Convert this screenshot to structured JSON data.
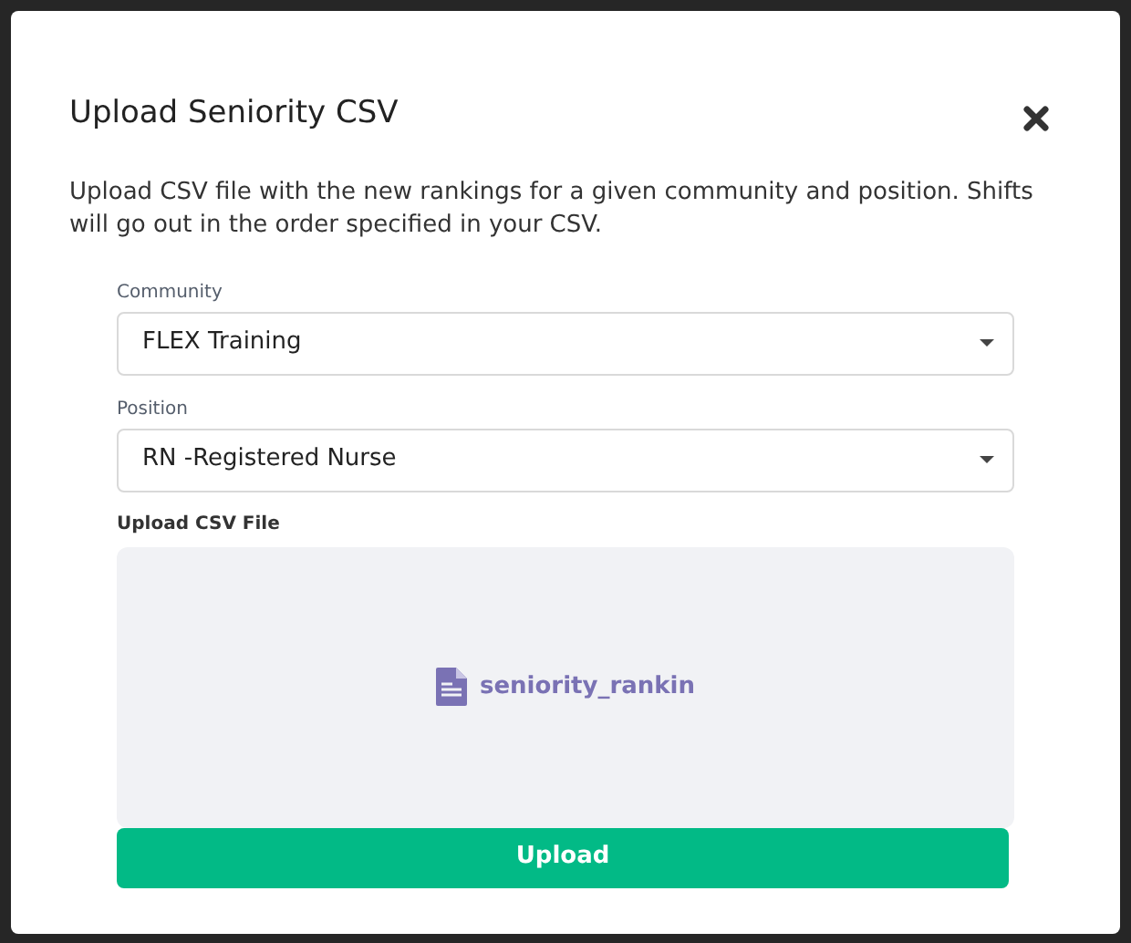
{
  "dialog": {
    "title": "Upload Seniority CSV",
    "description": "Upload CSV file with the new rankings for a given community and position. Shifts will go out in the order specified in your CSV."
  },
  "fields": [
    {
      "label": "Community",
      "value": "FLEX Training"
    },
    {
      "label": "Position",
      "value": "RN -Registered Nurse"
    }
  ],
  "upload": {
    "label": "Upload CSV File",
    "file_name": "seniority_rankin"
  },
  "buttons": [
    "Upload"
  ]
}
